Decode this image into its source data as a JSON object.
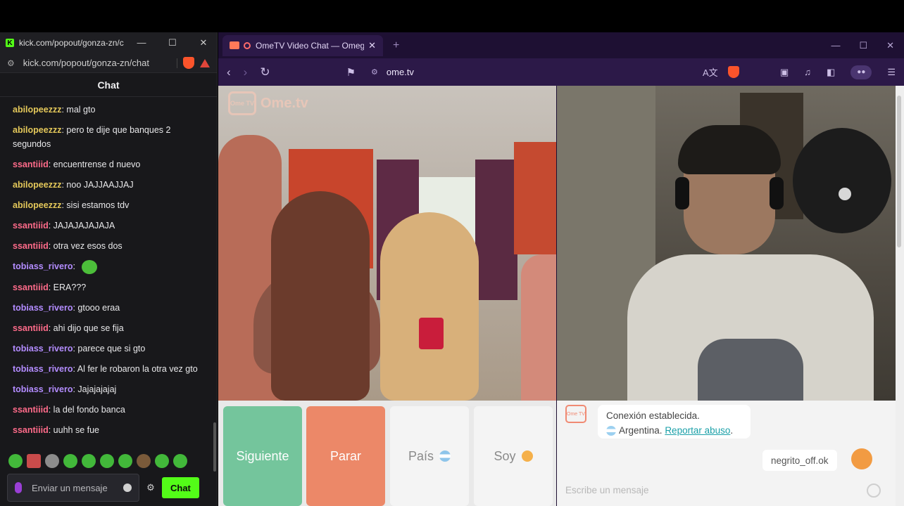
{
  "popout": {
    "title": "kick.com/popout/gonza-zn/c",
    "address": "kick.com/popout/gonza-zn/chat",
    "window_controls": {
      "minimize": "—",
      "maximize": "☐",
      "close": "✕"
    },
    "chat_header": "Chat",
    "messages": [
      {
        "user": "abilopeezzz",
        "text": "mal gto",
        "color": "gold"
      },
      {
        "user": "abilopeezzz",
        "text": "pero te dije que banques 2 segundos",
        "color": "gold"
      },
      {
        "user": "ssantiiid",
        "text": "encuentrense d nuevo",
        "color": "pink"
      },
      {
        "user": "abilopeezzz",
        "text": "noo JAJJAAJJAJ",
        "color": "gold"
      },
      {
        "user": "abilopeezzz",
        "text": "sisi estamos tdv",
        "color": "gold"
      },
      {
        "user": "ssantiiid",
        "text": "JAJAJAJAJAJA",
        "color": "pink"
      },
      {
        "user": "ssantiiid",
        "text": "otra vez esos dos",
        "color": "pink"
      },
      {
        "user": "tobiass_rivero",
        "text": "",
        "emote": "green-emote-icon",
        "color": "purple"
      },
      {
        "user": "ssantiiid",
        "text": "ERA???",
        "color": "pink"
      },
      {
        "user": "tobiass_rivero",
        "text": "gtooo eraa",
        "color": "purple"
      },
      {
        "user": "ssantiiid",
        "text": "ahi dijo que se fija",
        "color": "pink"
      },
      {
        "user": "tobiass_rivero",
        "text": "parece que si gto",
        "color": "purple"
      },
      {
        "user": "tobiass_rivero",
        "text": "Al fer le robaron la otra vez gto",
        "color": "purple"
      },
      {
        "user": "tobiass_rivero",
        "text": "Jajajajajaj",
        "color": "purple"
      },
      {
        "user": "ssantiiid",
        "text": "la del fondo banca",
        "color": "pink"
      },
      {
        "user": "ssantiiid",
        "text": "uuhh se fue",
        "color": "pink"
      }
    ],
    "input_placeholder": "Enviar un mensaje",
    "chat_button": "Chat",
    "accent_color": "#53fc18"
  },
  "browser": {
    "tab_title": "OmeTV Video Chat — Omeg",
    "url": "ome.tv",
    "window_controls": {
      "minimize": "—",
      "maximize": "☐",
      "close": "✕"
    },
    "logo_text": "Ome.tv",
    "logo_badge": "Ome TV",
    "buttons": {
      "next": "Siguiente",
      "stop": "Parar",
      "country": "País",
      "gender": "Soy"
    },
    "chat": {
      "status": "Conexión establecida.",
      "country": "Argentina.",
      "report": "Reportar abuso",
      "report_suffix": ".",
      "user_tag": "negrito_off.ok",
      "input_placeholder": "Escribe un mensaje"
    }
  }
}
